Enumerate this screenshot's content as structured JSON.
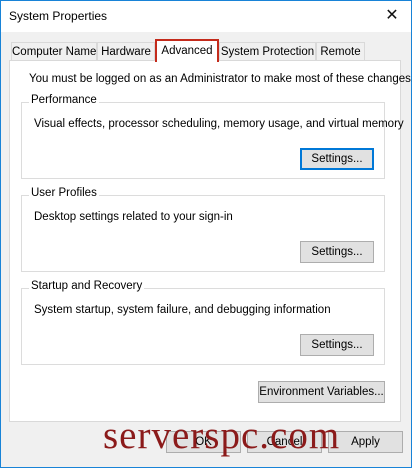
{
  "window": {
    "title": "System Properties",
    "close_glyph": "✕"
  },
  "tabs": [
    {
      "label": "Computer Name"
    },
    {
      "label": "Hardware"
    },
    {
      "label": "Advanced"
    },
    {
      "label": "System Protection"
    },
    {
      "label": "Remote"
    }
  ],
  "active_tab": "Advanced",
  "colors": {
    "active_tab_highlight": "#c42b1c",
    "focus_border": "#0078d7",
    "watermark": "#8b1a1a",
    "window_border": "#1883d7"
  },
  "advanced": {
    "note": "You must be logged on as an Administrator to make most of these changes.",
    "performance": {
      "title": "Performance",
      "description": "Visual effects, processor scheduling, memory usage, and virtual memory",
      "button": "Settings..."
    },
    "user_profiles": {
      "title": "User Profiles",
      "description": "Desktop settings related to your sign-in",
      "button": "Settings..."
    },
    "startup_recovery": {
      "title": "Startup and Recovery",
      "description": "System startup, system failure, and debugging information",
      "button": "Settings..."
    },
    "environment_button": "Environment Variables..."
  },
  "footer": {
    "ok": "OK",
    "cancel": "Cancel",
    "apply": "Apply"
  },
  "watermark": "serverspc.com"
}
